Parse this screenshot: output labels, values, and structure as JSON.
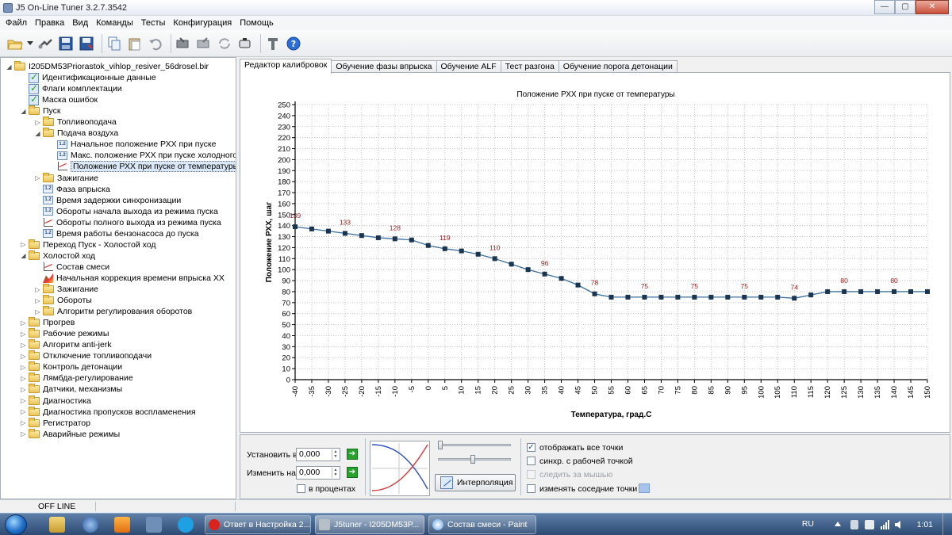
{
  "window": {
    "title": "J5 On-Line Tuner 3.2.7.3542",
    "minimize": "—",
    "maximize": "▢",
    "close": "✕"
  },
  "menu": [
    "Файл",
    "Правка",
    "Вид",
    "Команды",
    "Тесты",
    "Конфигурация",
    "Помощь"
  ],
  "tree": [
    {
      "label": "I205DM53Priorastok_vihlop_resiver_56drosel.bir",
      "icon": "folder",
      "level": 0,
      "twisty": "◢"
    },
    {
      "label": "Идентификационные данные",
      "icon": "check",
      "level": 1,
      "twisty": ""
    },
    {
      "label": "Флаги комплектации",
      "icon": "check",
      "level": 1,
      "twisty": ""
    },
    {
      "label": "Маска ошибок",
      "icon": "check",
      "level": 1,
      "twisty": ""
    },
    {
      "label": "Пуск",
      "icon": "folder",
      "level": 1,
      "twisty": "◢"
    },
    {
      "label": "Топливоподача",
      "icon": "folder",
      "level": 2,
      "twisty": "▷"
    },
    {
      "label": "Подача воздуха",
      "icon": "folder",
      "level": 2,
      "twisty": "◢"
    },
    {
      "label": "Начальное положение РХХ при пуске",
      "icon": "num",
      "level": 3,
      "twisty": ""
    },
    {
      "label": "Макс. положение РХХ при пуске холодного д",
      "icon": "num",
      "level": 3,
      "twisty": ""
    },
    {
      "label": "Положение РХХ при пуске от температуры",
      "icon": "graph",
      "level": 3,
      "twisty": "",
      "selected": true
    },
    {
      "label": "Зажигание",
      "icon": "folder",
      "level": 2,
      "twisty": "▷"
    },
    {
      "label": "Фаза впрыска",
      "icon": "num",
      "level": 2,
      "twisty": ""
    },
    {
      "label": "Время задержки синхронизации",
      "icon": "num",
      "level": 2,
      "twisty": ""
    },
    {
      "label": "Обороты начала выхода из режима пуска",
      "icon": "num",
      "level": 2,
      "twisty": ""
    },
    {
      "label": "Обороты полного выхода из режима пуска",
      "icon": "graph",
      "level": 2,
      "twisty": ""
    },
    {
      "label": "Время работы бензонасоса до пуска",
      "icon": "num",
      "level": 2,
      "twisty": ""
    },
    {
      "label": "Переход Пуск - Холостой ход",
      "icon": "folder",
      "level": 1,
      "twisty": "▷"
    },
    {
      "label": "Холостой ход",
      "icon": "folder",
      "level": 1,
      "twisty": "◢"
    },
    {
      "label": "Состав смеси",
      "icon": "graph",
      "level": 2,
      "twisty": ""
    },
    {
      "label": "Начальная коррекция времени впрыска ХХ",
      "icon": "3d",
      "level": 2,
      "twisty": ""
    },
    {
      "label": "Зажигание",
      "icon": "folder",
      "level": 2,
      "twisty": "▷"
    },
    {
      "label": "Обороты",
      "icon": "folder",
      "level": 2,
      "twisty": "▷"
    },
    {
      "label": "Алгоритм регулирования оборотов",
      "icon": "folder",
      "level": 2,
      "twisty": "▷"
    },
    {
      "label": "Прогрев",
      "icon": "folder",
      "level": 1,
      "twisty": "▷"
    },
    {
      "label": "Рабочие режимы",
      "icon": "folder",
      "level": 1,
      "twisty": "▷"
    },
    {
      "label": "Алгоритм anti-jerk",
      "icon": "folder",
      "level": 1,
      "twisty": "▷"
    },
    {
      "label": "Отключение топливоподачи",
      "icon": "folder",
      "level": 1,
      "twisty": "▷"
    },
    {
      "label": "Контроль детонации",
      "icon": "folder",
      "level": 1,
      "twisty": "▷"
    },
    {
      "label": "Лямбда-регулирование",
      "icon": "folder",
      "level": 1,
      "twisty": "▷"
    },
    {
      "label": "Датчики, механизмы",
      "icon": "folder",
      "level": 1,
      "twisty": "▷"
    },
    {
      "label": "Диагностика",
      "icon": "folder",
      "level": 1,
      "twisty": "▷"
    },
    {
      "label": "Диагностика пропусков воспламенения",
      "icon": "folder",
      "level": 1,
      "twisty": "▷"
    },
    {
      "label": "Регистратор",
      "icon": "folder",
      "level": 1,
      "twisty": "▷"
    },
    {
      "label": "Аварийные режимы",
      "icon": "folder",
      "level": 1,
      "twisty": "▷"
    }
  ],
  "tabs": [
    "Редактор калибровок",
    "Обучение фазы впрыска",
    "Обучение ALF",
    "Тест разгона",
    "Обучение порога детонации"
  ],
  "chart_data": {
    "type": "line",
    "title": "Положение РХХ при пуске от температуры",
    "xlabel": "Температура, град.С",
    "ylabel": "Положение РХХ, шаг",
    "x": [
      -40,
      -35,
      -30,
      -25,
      -20,
      -15,
      -10,
      -5,
      0,
      5,
      10,
      15,
      20,
      25,
      30,
      35,
      40,
      45,
      50,
      55,
      60,
      65,
      70,
      75,
      80,
      85,
      90,
      95,
      100,
      105,
      110,
      115,
      120,
      125,
      130,
      135,
      140,
      145,
      150
    ],
    "values": [
      139,
      137,
      135,
      133,
      131,
      129,
      128,
      127,
      122,
      119,
      117,
      114,
      110,
      105,
      100,
      96,
      92,
      86,
      78,
      75,
      75,
      75,
      75,
      75,
      75,
      75,
      75,
      75,
      75,
      75,
      74,
      77,
      80,
      80,
      80,
      80,
      80,
      80,
      80
    ],
    "data_labels": [
      {
        "x": -40,
        "text": "139"
      },
      {
        "x": -25,
        "text": "133"
      },
      {
        "x": -10,
        "text": "128"
      },
      {
        "x": 5,
        "text": "119"
      },
      {
        "x": 20,
        "text": "110"
      },
      {
        "x": 35,
        "text": "96"
      },
      {
        "x": 50,
        "text": "78"
      },
      {
        "x": 65,
        "text": "75"
      },
      {
        "x": 80,
        "text": "75"
      },
      {
        "x": 95,
        "text": "75"
      },
      {
        "x": 110,
        "text": "74"
      },
      {
        "x": 125,
        "text": "80"
      },
      {
        "x": 140,
        "text": "80"
      }
    ],
    "xlim": [
      -40,
      150
    ],
    "ylim": [
      0,
      250
    ],
    "xticks": [
      -40,
      -35,
      -30,
      -25,
      -20,
      -15,
      -10,
      -5,
      0,
      5,
      10,
      15,
      20,
      25,
      30,
      35,
      40,
      45,
      50,
      55,
      60,
      65,
      70,
      75,
      80,
      85,
      90,
      95,
      100,
      105,
      110,
      115,
      120,
      125,
      130,
      135,
      140,
      145,
      150
    ],
    "yticks": [
      0,
      10,
      20,
      30,
      40,
      50,
      60,
      70,
      80,
      90,
      100,
      110,
      120,
      130,
      140,
      150,
      160,
      170,
      180,
      190,
      200,
      210,
      220,
      230,
      240,
      250
    ],
    "grid": true,
    "colors": {
      "line": "#3a6e9f",
      "marker": "#1b3550",
      "label": "#9b1c1c",
      "grid": "#b5b5b5"
    }
  },
  "controls": {
    "set_label": "Установить в",
    "set_value": "0,000",
    "change_label": "Изменить на",
    "change_value": "0,000",
    "percent_label": "в процентах",
    "interp_label": "Интерполяция",
    "show_all_points": "отображать все точки",
    "sync_work_point": "синхр. с рабочей точкой",
    "follow_mouse": "следить за мышью",
    "change_neighbors": "изменять соседние точки",
    "arrow": "➔"
  },
  "status": {
    "mode": "OFF LINE"
  },
  "taskbar": {
    "tasks": [
      "Ответ в Настройка 2...",
      "J5tuner - I205DM53P...",
      "Состав смеси - Paint"
    ],
    "lang": "RU",
    "clock": "1:01"
  }
}
